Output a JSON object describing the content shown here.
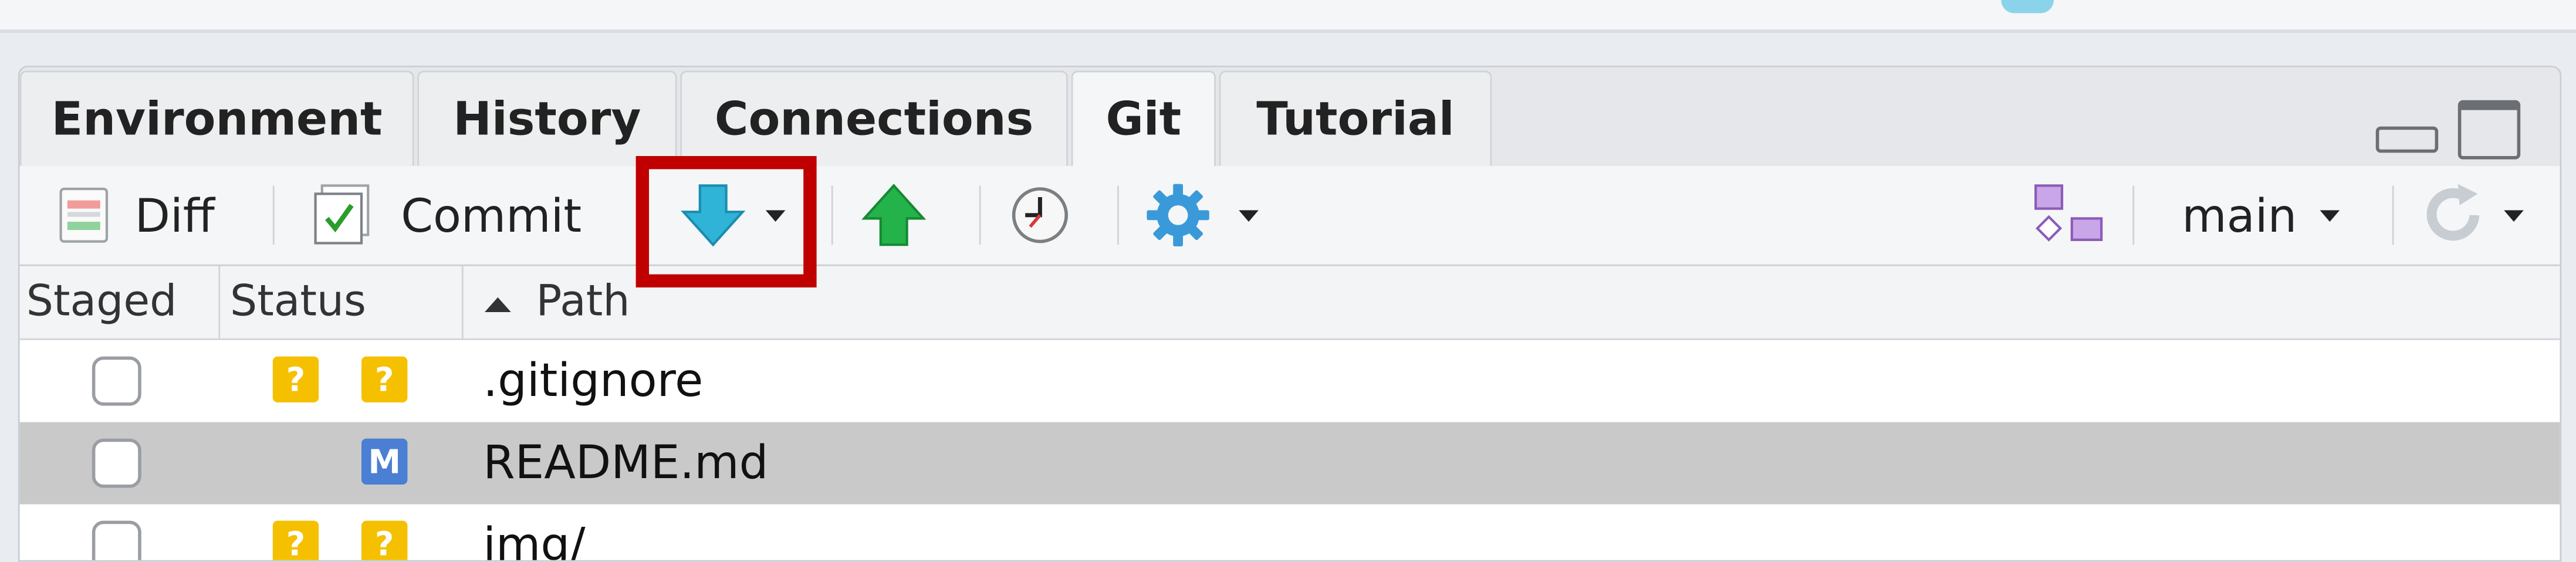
{
  "tabs": [
    {
      "label": "Environment"
    },
    {
      "label": "History"
    },
    {
      "label": "Connections"
    },
    {
      "label": "Git",
      "active": true
    },
    {
      "label": "Tutorial"
    }
  ],
  "toolbar": {
    "diff_label": "Diff",
    "commit_label": "Commit",
    "branch_label": "main",
    "pull_icon": "pull-arrow-down-icon",
    "push_icon": "push-arrow-up-icon",
    "history_icon": "clock-icon",
    "more_icon": "gear-icon",
    "new_branch_icon": "branch-diagram-icon",
    "refresh_icon": "refresh-icon"
  },
  "columns": {
    "staged": "Staged",
    "status": "Status",
    "path": "Path",
    "path_sort": "ascending"
  },
  "files": [
    {
      "path": ".gitignore",
      "status_left": "?",
      "status_right": "?",
      "selected": false
    },
    {
      "path": "README.md",
      "status_left": "",
      "status_right": "M",
      "selected": true
    },
    {
      "path": "img/",
      "status_left": "?",
      "status_right": "?",
      "selected": false
    }
  ],
  "colors": {
    "highlight": "#c00000",
    "untracked_badge": "#f5c000",
    "modified_badge": "#4a7fd3",
    "selected_row": "#c9c9c9"
  }
}
